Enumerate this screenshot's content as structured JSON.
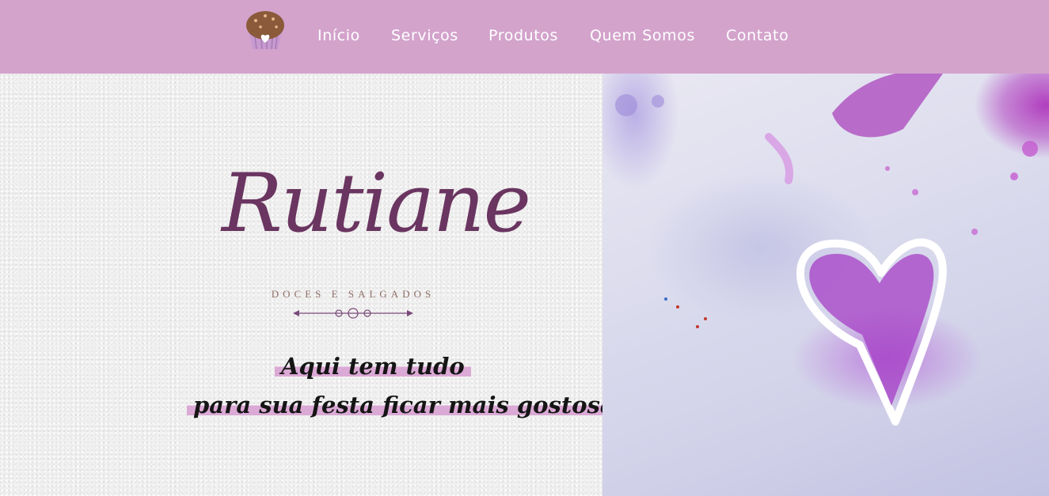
{
  "nav": {
    "logo_icon": "cupcake-icon",
    "items": [
      {
        "label": "Início"
      },
      {
        "label": "Serviços"
      },
      {
        "label": "Produtos"
      },
      {
        "label": "Quem Somos"
      },
      {
        "label": "Contato"
      }
    ]
  },
  "hero": {
    "brand": "Rutiane",
    "subtitle": "DOCES E SALGADOS",
    "tagline_line1": "Aqui tem tudo",
    "tagline_line2": "para sua festa ficar mais gostosa!"
  },
  "colors": {
    "nav_bg": "#d3a3cc",
    "brand_purple": "#6a3561",
    "highlight": "#dba9d5"
  }
}
